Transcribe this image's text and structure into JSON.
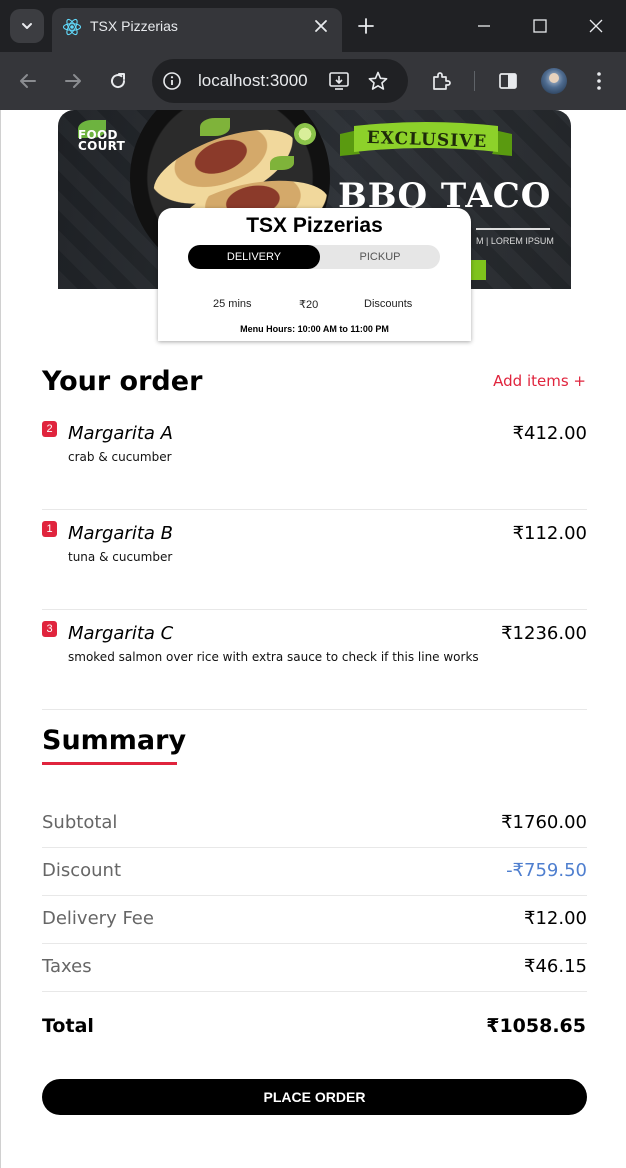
{
  "browser": {
    "tab_title": "TSX Pizzerias",
    "url": "localhost:3000"
  },
  "banner": {
    "brand": "FOOD COURT",
    "badge": "EXCLUSIVE",
    "headline": "BBQ TACO",
    "subline": "M | LOREM IPSUM"
  },
  "restaurant": {
    "name": "TSX Pizzerias",
    "modes": {
      "delivery": "DELIVERY",
      "pickup": "PICKUP",
      "selected": "DELIVERY"
    },
    "eta": "25 mins",
    "fee": "₹20",
    "discounts": "Discounts",
    "hours": "Menu Hours: 10:00 AM to 11:00 PM"
  },
  "order": {
    "title": "Your order",
    "add_items": "Add items +",
    "items": [
      {
        "qty": "2",
        "name": "Margarita A",
        "desc": "crab & cucumber",
        "price": "₹412.00"
      },
      {
        "qty": "1",
        "name": "Margarita B",
        "desc": "tuna & cucumber",
        "price": "₹112.00"
      },
      {
        "qty": "3",
        "name": "Margarita C",
        "desc": "smoked salmon over rice with extra sauce to check if this line works",
        "price": "₹1236.00"
      }
    ]
  },
  "summary": {
    "title": "Summary",
    "rows": [
      {
        "label": "Subtotal",
        "value": "₹1760.00"
      },
      {
        "label": "Discount",
        "value": "-₹759.50"
      },
      {
        "label": "Delivery Fee",
        "value": "₹12.00"
      },
      {
        "label": "Taxes",
        "value": "₹46.15"
      }
    ],
    "total_label": "Total",
    "total_value": "₹1058.65"
  },
  "cta": {
    "place_order": "PLACE ORDER"
  },
  "colors": {
    "accent": "#e0243d",
    "discount": "#4f7fcf",
    "chrome_dark": "#202124",
    "chrome_toolbar": "#35363a"
  },
  "icons": [
    "tab-list-icon",
    "react-favicon-icon",
    "close-tab-icon",
    "new-tab-icon",
    "minimize-icon",
    "maximize-icon",
    "window-close-icon",
    "back-icon",
    "forward-icon",
    "reload-icon",
    "site-info-icon",
    "install-app-icon",
    "bookmark-star-icon",
    "extensions-icon",
    "side-panel-icon",
    "profile-avatar",
    "kebab-menu-icon"
  ]
}
